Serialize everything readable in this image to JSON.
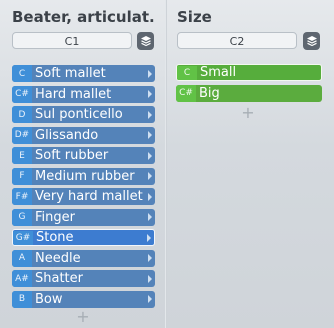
{
  "left": {
    "title": "Beater, articulat.",
    "selector_value": "C1",
    "items": [
      {
        "key": "C",
        "label": "Soft mallet"
      },
      {
        "key": "C#",
        "label": "Hard mallet"
      },
      {
        "key": "D",
        "label": "Sul ponticello"
      },
      {
        "key": "D#",
        "label": "Glissando"
      },
      {
        "key": "E",
        "label": "Soft rubber"
      },
      {
        "key": "F",
        "label": "Medium rubber"
      },
      {
        "key": "F#",
        "label": "Very hard mallet"
      },
      {
        "key": "G",
        "label": "Finger"
      },
      {
        "key": "G#",
        "label": "Stone",
        "selected": true
      },
      {
        "key": "A",
        "label": "Needle"
      },
      {
        "key": "A#",
        "label": "Shatter"
      },
      {
        "key": "B",
        "label": "Bow"
      }
    ],
    "add_symbol": "+"
  },
  "right": {
    "title": "Size",
    "selector_value": "C2",
    "items": [
      {
        "key": "C",
        "label": "Small",
        "selected": true
      },
      {
        "key": "C#",
        "label": "Big"
      }
    ],
    "add_symbol": "+"
  },
  "colors": {
    "row_blue": "#5483b9",
    "key_blue": "#3f8fd8",
    "selected_blue": "#3d7cd0",
    "row_green": "#5bac3e",
    "key_green": "#61c246"
  },
  "icons": {
    "layers": "layers-icon",
    "row_arrow": "chevron-right-icon",
    "add": "plus-icon"
  }
}
